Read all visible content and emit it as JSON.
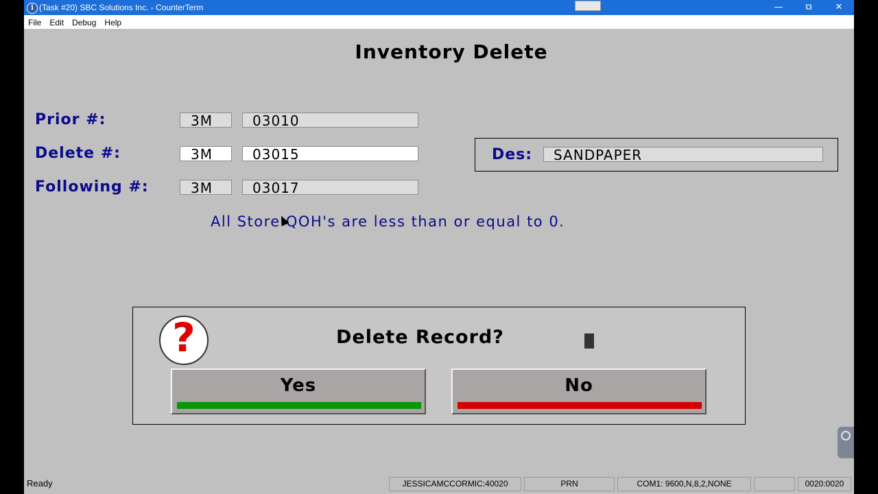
{
  "window": {
    "title": "(Task #20) SBC Solutions Inc. - CounterTerm",
    "app_icon": "i",
    "minimize": "—",
    "maximize": "⧉",
    "close": "✕"
  },
  "menu": [
    "File",
    "Edit",
    "Debug",
    "Help"
  ],
  "screen": {
    "title": "Inventory Delete",
    "prior": {
      "label": "Prior #:",
      "code": "3M",
      "number": "03010"
    },
    "delete": {
      "label": "Delete #:",
      "code": "3M",
      "number": "03015"
    },
    "following": {
      "label": "Following #:",
      "code": "3M",
      "number": "03017"
    },
    "description": {
      "label": "Des:",
      "value": "SANDPAPER"
    },
    "message": "All Store QOH's are less than or equal to 0."
  },
  "dialog": {
    "icon": "question-icon",
    "icon_glyph": "?",
    "title": "Delete Record?",
    "yes_label": "Yes",
    "no_label": "No",
    "yes_color": "#079707",
    "no_color": "#d60000"
  },
  "status": {
    "ready": "Ready",
    "user": "JESSICAMCCORMIC:40020",
    "printer": "PRN",
    "port": "COM1: 9600,N,8,2,NONE",
    "empty": "",
    "position": "0020:0020"
  }
}
